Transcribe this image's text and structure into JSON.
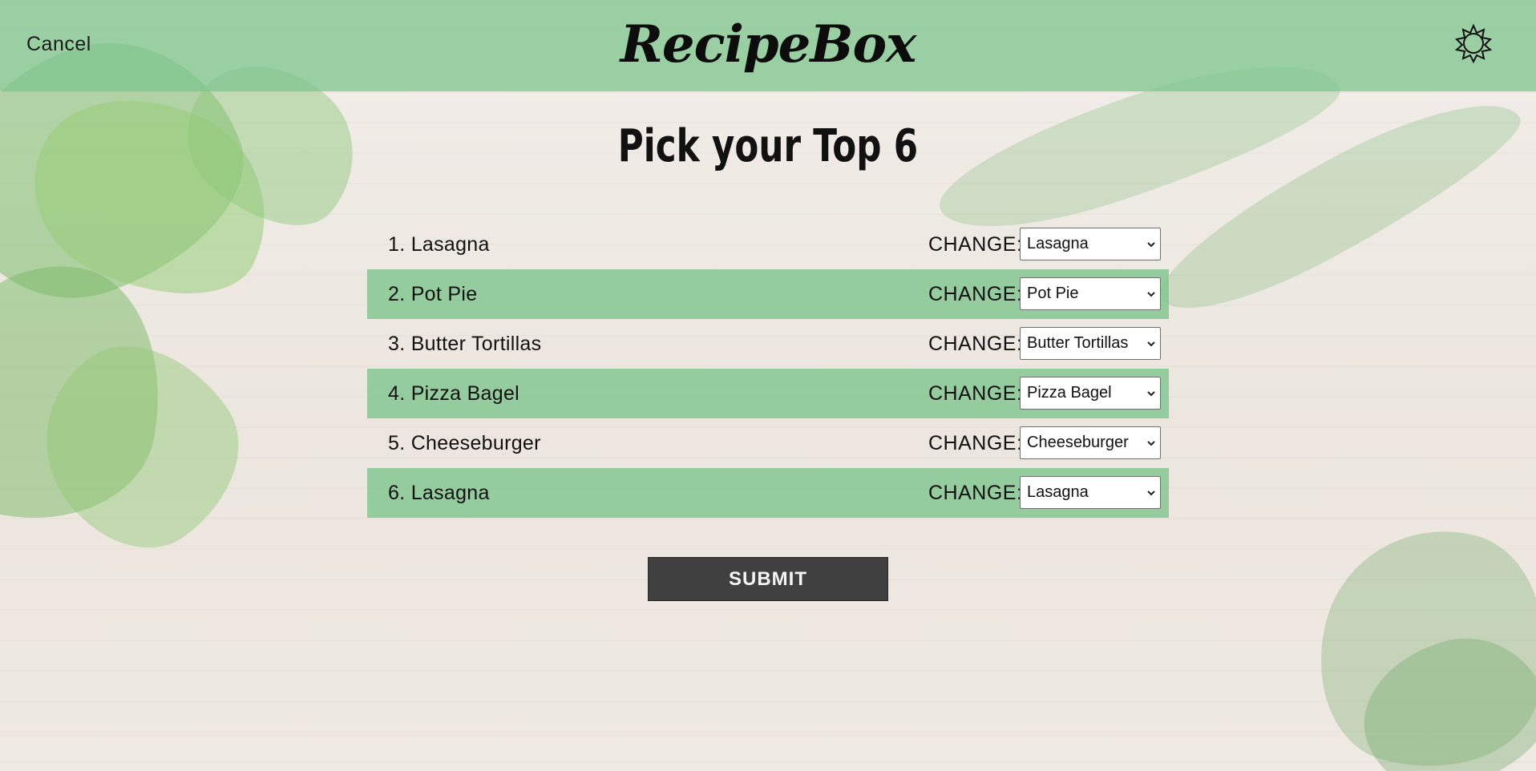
{
  "header": {
    "cancel_label": "Cancel",
    "logo": "RecipeBox",
    "settings_icon": "gear-icon"
  },
  "page": {
    "title": "Pick your Top 6"
  },
  "top_list": [
    {
      "label": "1. Lasagna",
      "change_label": "CHANGE:",
      "selected": "Lasagna"
    },
    {
      "label": "2. Pot Pie",
      "change_label": "CHANGE:",
      "selected": "Pot Pie"
    },
    {
      "label": "3. Butter Tortillas",
      "change_label": "CHANGE:",
      "selected": "Butter Tortillas"
    },
    {
      "label": "4. Pizza Bagel",
      "change_label": "CHANGE:",
      "selected": "Pizza Bagel"
    },
    {
      "label": "5. Cheeseburger",
      "change_label": "CHANGE:",
      "selected": "Cheeseburger"
    },
    {
      "label": "6. Lasagna",
      "change_label": "CHANGE:",
      "selected": "Lasagna"
    }
  ],
  "submit_label": "SUBMIT",
  "colors": {
    "header_green": "#80c68f",
    "row_green": "#80c68f",
    "submit_bg": "#404040"
  }
}
